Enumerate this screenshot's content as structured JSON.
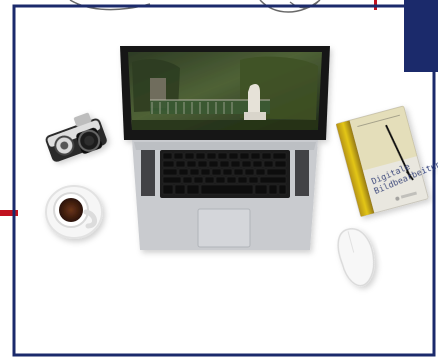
{
  "book": {
    "title_line1": "Digitale",
    "title_line2": "Bildbearbeitung"
  },
  "colors": {
    "frame": "#1b2a6b",
    "accent_red": "#c1121f",
    "desk": "#ffffff",
    "laptop_body": "#c9cbcf",
    "screen_bezel": "#111111",
    "coffee": "#5a2a12",
    "book_cover": "#e9e7df"
  }
}
